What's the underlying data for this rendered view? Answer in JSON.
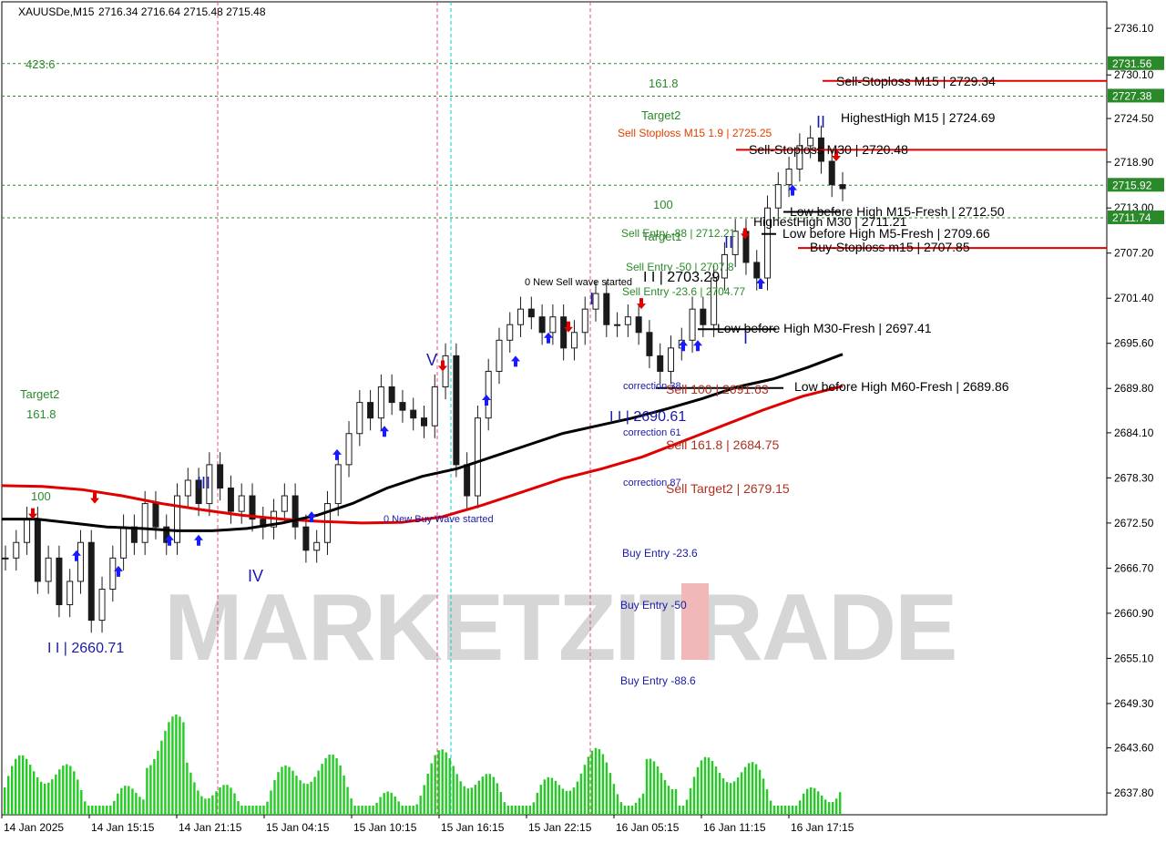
{
  "header": {
    "symbol": "XAUUSDe,M15",
    "ohlc": "2716.34 2716.64 2715.48 2715.48"
  },
  "watermark": "MARKETZITRADE",
  "colors": {
    "bull_candle": "#1a1a1a",
    "bear_candle": "#1a1a1a",
    "ma_fast": "#000000",
    "ma_slow": "#e00000",
    "volume": "#22cc22",
    "grid_price_level": "#2a8a2a",
    "sell_level": "#e00000",
    "buy_arrow": "#1a1aff",
    "sell_arrow": "#e00000",
    "session_line": "#e05080",
    "cursor_line": "#00cccc"
  },
  "chart_data": {
    "type": "line",
    "title": "XAUUSDe,M15",
    "ylim": [
      2635.0,
      2739.5
    ],
    "y_ticks": [
      "2736.10",
      "2730.10",
      "2724.50",
      "2718.90",
      "2713.00",
      "2707.20",
      "2701.40",
      "2695.60",
      "2689.80",
      "2684.10",
      "2678.30",
      "2672.50",
      "2666.70",
      "2660.90",
      "2655.10",
      "2649.30",
      "2643.60",
      "2637.80"
    ],
    "x_ticks": [
      "14 Jan 2025",
      "14 Jan 15:15",
      "14 Jan 21:15",
      "15 Jan 04:15",
      "15 Jan 10:15",
      "15 Jan 16:15",
      "15 Jan 22:15",
      "16 Jan 05:15",
      "16 Jan 11:15",
      "16 Jan 17:15"
    ],
    "price_badges": [
      {
        "value": "2731.56",
        "price": 2731.56
      },
      {
        "value": "2727.38",
        "price": 2727.38
      },
      {
        "value": "2715.92",
        "price": 2715.92
      },
      {
        "value": "2711.74",
        "price": 2711.74
      }
    ],
    "close_series": [
      2668,
      2670,
      2673,
      2665,
      2668,
      2662,
      2665,
      2670,
      2660,
      2664,
      2668,
      2672,
      2670,
      2675,
      2672,
      2670,
      2676,
      2678,
      2675,
      2680,
      2677,
      2674,
      2676,
      2673,
      2672,
      2674,
      2676,
      2672,
      2669,
      2670,
      2675,
      2680,
      2684,
      2688,
      2686,
      2690,
      2688,
      2687,
      2686,
      2685,
      2690,
      2694,
      2680,
      2676,
      2686,
      2692,
      2696,
      2698,
      2700,
      2699,
      2697,
      2699,
      2695,
      2697,
      2700,
      2702,
      2698,
      2698,
      2699,
      2697,
      2694,
      2692,
      2695,
      2696,
      2700,
      2698,
      2704,
      2707,
      2710,
      2706,
      2704,
      2713,
      2716,
      2718,
      2721,
      2722,
      2719,
      2716,
      2715.48
    ],
    "ma_fast": [
      2673,
      2673,
      2672.5,
      2672,
      2671.8,
      2671.5,
      2671.5,
      2671.8,
      2672.5,
      2673.5,
      2675,
      2677,
      2678.5,
      2679.5,
      2681,
      2682.5,
      2684,
      2685,
      2686,
      2687.2,
      2688.5,
      2690,
      2691,
      2692.5,
      2694.2
    ],
    "ma_slow": [
      2677.3,
      2677.2,
      2676.8,
      2676,
      2675,
      2674.2,
      2673.5,
      2673,
      2672.7,
      2672.5,
      2672.6,
      2673.3,
      2674.8,
      2676.5,
      2678.2,
      2679.5,
      2681,
      2683,
      2685,
      2687,
      2688.8,
      2690.1
    ],
    "annotations": [
      {
        "text": "Sell-Stoploss M15 | 2729.34",
        "price": 2729.34,
        "color": "#000000"
      },
      {
        "text": "HighestHigh   M15 | 2724.69",
        "price": 2724.69,
        "color": "#000000"
      },
      {
        "text": "Sell-Stoploss M30 | 2720.48",
        "price": 2720.48,
        "color": "#000000"
      },
      {
        "text": "Low before High   M15-Fresh | 2712.50",
        "price": 2712.5,
        "color": "#000000"
      },
      {
        "text": "HighestHigh  M30 | 2711.21",
        "price": 2711.21,
        "color": "#000000"
      },
      {
        "text": "Low before High   M5-Fresh | 2709.66",
        "price": 2709.66,
        "color": "#000000"
      },
      {
        "text": "Buy-Stoploss m15 | 2707.85",
        "price": 2707.85,
        "color": "#000000"
      },
      {
        "text": "Low before High   M30-Fresh | 2697.41",
        "price": 2697.41,
        "color": "#000000"
      },
      {
        "text": "Low before High   M60-Fresh | 2689.86",
        "price": 2689.86,
        "color": "#000000"
      },
      {
        "text": "Sell 161.8 | 2684.75",
        "price": 2684.75,
        "color": "#b03020"
      },
      {
        "text": "Sell Target2 | 2679.15",
        "price": 2679.15,
        "color": "#b03020"
      },
      {
        "text": "Sell 100 | 2691.63",
        "price": 2691.63,
        "color": "#b03020"
      },
      {
        "text": "Sell Stoploss M15 1.9 | 2725.25",
        "price": 2725.25,
        "color": "#e04000"
      },
      {
        "text": "Sell Entry -88 | 2712.21",
        "price": 2712.21,
        "color": "#2a8a2a"
      },
      {
        "text": "Sell Entry -50 | 2707.8",
        "price": 2707.8,
        "color": "#2a8a2a"
      },
      {
        "text": "Sell Entry -23.6 | 2704.77",
        "price": 2704.77,
        "color": "#2a8a2a"
      },
      {
        "text": "I I | 2703.29",
        "price": 2703.29,
        "color": "#000000"
      },
      {
        "text": "I I | 2690.61",
        "price": 2690.61,
        "color": "#1a1aaa"
      },
      {
        "text": "I I | 2660.71",
        "price": 2660.71,
        "color": "#1a1aaa"
      },
      {
        "text": "Buy Entry -23.6",
        "price": 2670.0,
        "color": "#1a1aaa"
      },
      {
        "text": "Buy Entry -50",
        "price": 2663.5,
        "color": "#1a1aaa"
      },
      {
        "text": "Buy Entry -88.6",
        "price": 2653.5,
        "color": "#1a1aaa"
      },
      {
        "text": "correction 38",
        "price": 2690.5,
        "color": "#1a1aaa"
      },
      {
        "text": "correction 61",
        "price": 2686.0,
        "color": "#1a1aaa"
      },
      {
        "text": "correction 87",
        "price": 2680.3,
        "color": "#1a1aaa"
      },
      {
        "text": "0 New Sell wave started",
        "price": 2705.7,
        "color": "#000000"
      },
      {
        "text": "0 New Buy Wave started",
        "price": 2674.0,
        "color": "#1a1aaa"
      }
    ],
    "fib_labels": [
      {
        "text": "423.6",
        "price": 2732.7
      },
      {
        "text": "161.8",
        "price": 2730.3
      },
      {
        "text": "Target2",
        "price": 2727.0
      },
      {
        "text": "100",
        "price": 2715.7
      },
      {
        "text": "Target1",
        "price": 2711.4
      },
      {
        "text": "Target2",
        "price": 2690.6
      },
      {
        "text": "161.8",
        "price": 2687.8
      },
      {
        "text": "100",
        "price": 2676.4
      }
    ],
    "wave_labels": [
      "I",
      "II",
      "III",
      "IV",
      "V",
      "I",
      "II",
      "III",
      "IV",
      "V"
    ]
  }
}
